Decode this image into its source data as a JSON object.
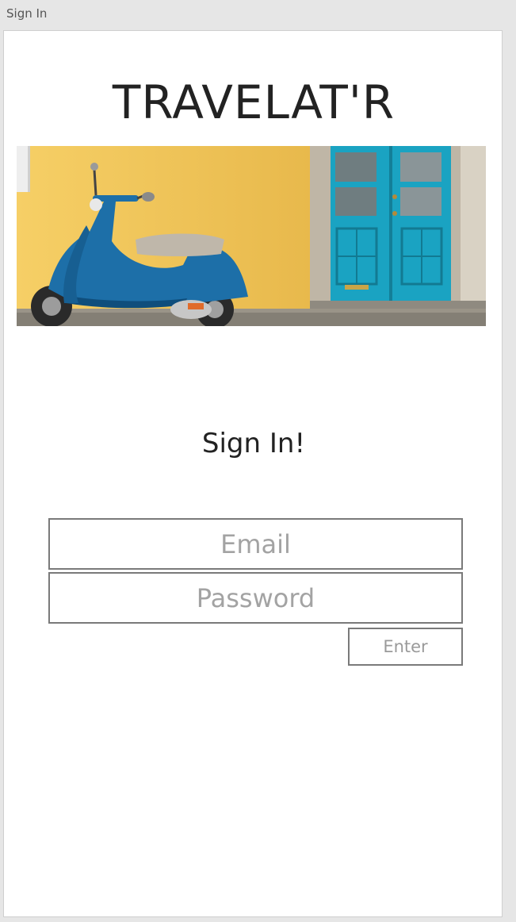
{
  "window": {
    "title": "Sign In"
  },
  "app": {
    "title": "TRAVELAT'R"
  },
  "hero": {
    "image": "scooter-yellow-wall-blue-door"
  },
  "signin": {
    "heading": "Sign In!",
    "email_placeholder": "Email",
    "password_placeholder": "Password",
    "enter_label": "Enter"
  },
  "colors": {
    "wall_yellow": "#f2c65a",
    "door_blue": "#1aa3c2",
    "scooter_blue": "#1d6fa8",
    "field_border": "#7a7a7a",
    "placeholder_text": "#a3a3a3"
  }
}
